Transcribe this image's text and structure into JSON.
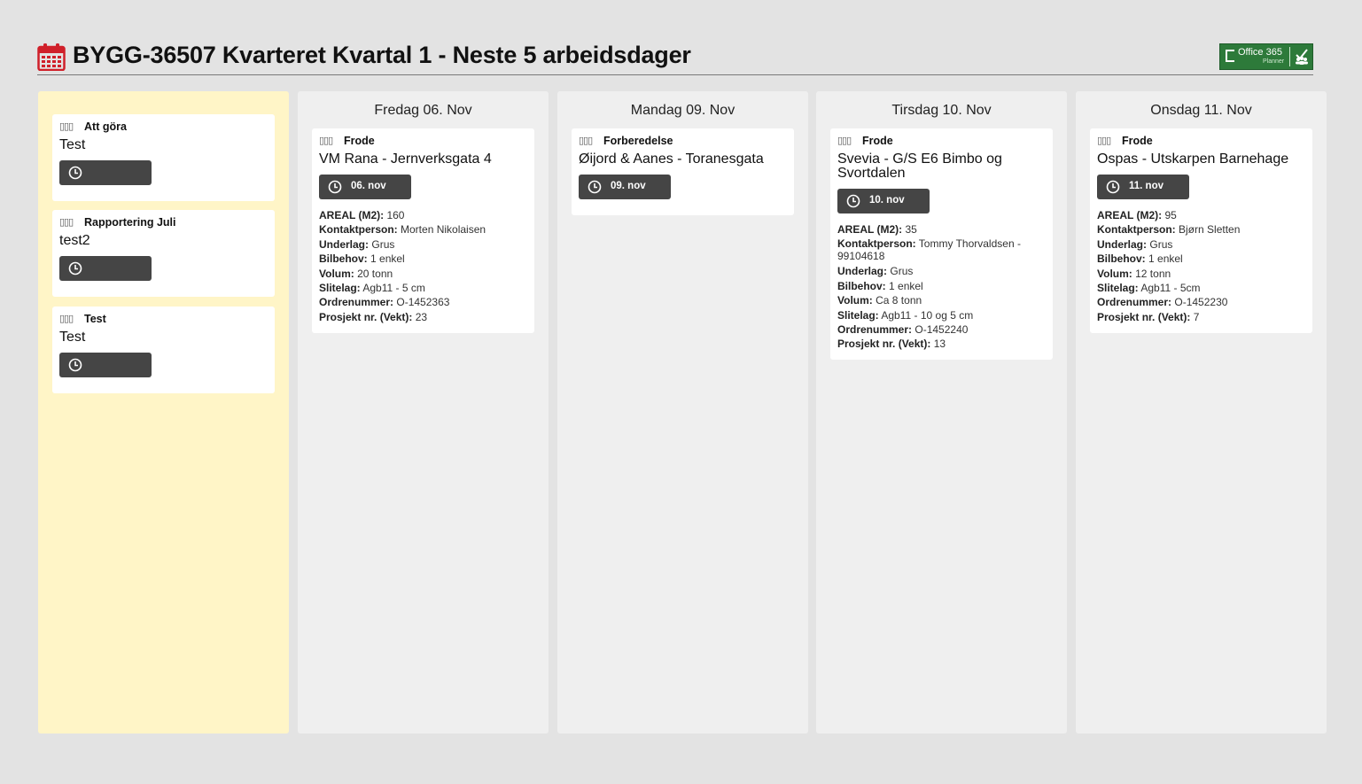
{
  "header": {
    "title": "BYGG-36507 Kvarteret Kvartal 1 - Neste 5 arbeidsdager",
    "calendar_icon": "calendar-icon",
    "badge": {
      "line1": "Office 365",
      "line2": "Planner",
      "icon": "office365-planner-logo"
    }
  },
  "colors": {
    "accent_red": "#d0202a",
    "backlog_bg": "#fff5c7",
    "column_bg": "#efefef",
    "due_bg": "#454545",
    "badge_green": "#2d7a3a"
  },
  "backlog": {
    "cards": [
      {
        "label": "Att göra",
        "title": "Test",
        "due": ""
      },
      {
        "label": "Rapportering Juli",
        "title": "test2",
        "due": ""
      },
      {
        "label": "Test",
        "title": "Test",
        "due": ""
      }
    ]
  },
  "days": [
    {
      "heading": "Fredag 06. Nov",
      "card": {
        "label": "Frode",
        "title": "VM Rana - Jernverksgata 4",
        "due": "06. nov",
        "details": [
          {
            "k": "AREAL (M2):",
            "v": "160"
          },
          {
            "k": "Kontaktperson:",
            "v": "Morten Nikolaisen"
          },
          {
            "k": "Underlag:",
            "v": "Grus"
          },
          {
            "k": "Bilbehov:",
            "v": "1 enkel"
          },
          {
            "k": "Volum:",
            "v": "20 tonn"
          },
          {
            "k": "Slitelag:",
            "v": "Agb11 - 5 cm"
          },
          {
            "k": "Ordrenummer:",
            "v": "O-1452363"
          },
          {
            "k": "Prosjekt nr. (Vekt):",
            "v": "23"
          }
        ]
      }
    },
    {
      "heading": "Mandag 09. Nov",
      "card": {
        "label": "Forberedelse",
        "title": "Øijord & Aanes - Toranesgata",
        "due": "09. nov",
        "details": []
      }
    },
    {
      "heading": "Tirsdag 10. Nov",
      "card": {
        "label": "Frode",
        "title": "Svevia - G/S E6 Bimbo og Svortdalen",
        "due": "10. nov",
        "details": [
          {
            "k": "AREAL (M2):",
            "v": "35"
          },
          {
            "k": "Kontaktperson:",
            "v": "Tommy Thorvaldsen - 99104618"
          },
          {
            "k": "Underlag:",
            "v": "Grus"
          },
          {
            "k": "Bilbehov:",
            "v": "1 enkel"
          },
          {
            "k": "Volum:",
            "v": "Ca 8 tonn"
          },
          {
            "k": "Slitelag:",
            "v": "Agb11 - 10 og 5 cm"
          },
          {
            "k": "Ordrenummer:",
            "v": "O-1452240"
          },
          {
            "k": "Prosjekt nr. (Vekt):",
            "v": "13"
          }
        ]
      }
    },
    {
      "heading": "Onsdag 11. Nov",
      "card": {
        "label": "Frode",
        "title": "Ospas - Utskarpen Barnehage",
        "due": "11. nov",
        "details": [
          {
            "k": "AREAL (M2):",
            "v": "95"
          },
          {
            "k": "Kontaktperson:",
            "v": "Bjørn Sletten"
          },
          {
            "k": "Underlag:",
            "v": "Grus"
          },
          {
            "k": "Bilbehov:",
            "v": "1 enkel"
          },
          {
            "k": "Volum:",
            "v": "12 tonn"
          },
          {
            "k": "Slitelag:",
            "v": "Agb11 - 5cm"
          },
          {
            "k": "Ordrenummer:",
            "v": "O-1452230"
          },
          {
            "k": "Prosjekt nr. (Vekt):",
            "v": "7"
          }
        ]
      }
    }
  ]
}
